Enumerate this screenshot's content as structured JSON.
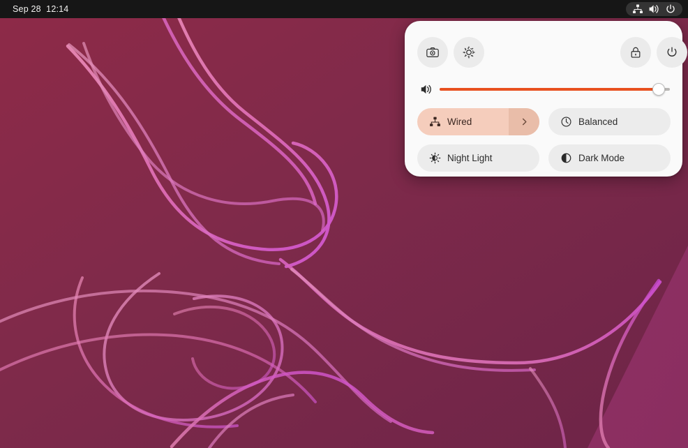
{
  "topbar": {
    "clock": "Sep 28  12:14",
    "indicators": [
      {
        "name": "network-wired-icon",
        "label": "Wired network"
      },
      {
        "name": "volume-icon",
        "label": "Volume"
      },
      {
        "name": "power-icon",
        "label": "Power"
      }
    ]
  },
  "quick_settings": {
    "header_buttons": [
      {
        "name": "screenshot-button",
        "icon": "camera-icon",
        "label": "Screenshot"
      },
      {
        "name": "settings-button",
        "icon": "gear-icon",
        "label": "Settings"
      },
      {
        "name": "lock-button",
        "icon": "lock-icon",
        "label": "Lock Screen"
      },
      {
        "name": "power-button",
        "icon": "power-icon",
        "label": "Power Off / Log Out"
      }
    ],
    "volume": {
      "icon": "speaker-volume-icon",
      "label": "Volume",
      "value": 95,
      "min": 0,
      "max": 100
    },
    "tiles": [
      {
        "name": "wired-tile",
        "icon": "network-wired-icon",
        "label": "Wired",
        "active": true,
        "has_submenu": true
      },
      {
        "name": "power-mode-tile",
        "icon": "speedometer-icon",
        "label": "Balanced",
        "active": false,
        "has_submenu": false
      },
      {
        "name": "night-light-tile",
        "icon": "night-light-icon",
        "label": "Night Light",
        "active": false,
        "has_submenu": false
      },
      {
        "name": "dark-mode-tile",
        "icon": "dark-mode-icon",
        "label": "Dark Mode",
        "active": false,
        "has_submenu": false
      }
    ]
  },
  "colors": {
    "accent_orange": "#e8501f",
    "panel_background": "#fafafa",
    "tile_inactive": "#ececec",
    "tile_active": "#f5cdbc",
    "topbar_background": "#161616",
    "wallpaper_dark": "#7d2a49",
    "wallpaper_light": "#8d2f5e",
    "ribbon_pink": "#e87ab0",
    "ribbon_magenta": "#d559d2"
  }
}
